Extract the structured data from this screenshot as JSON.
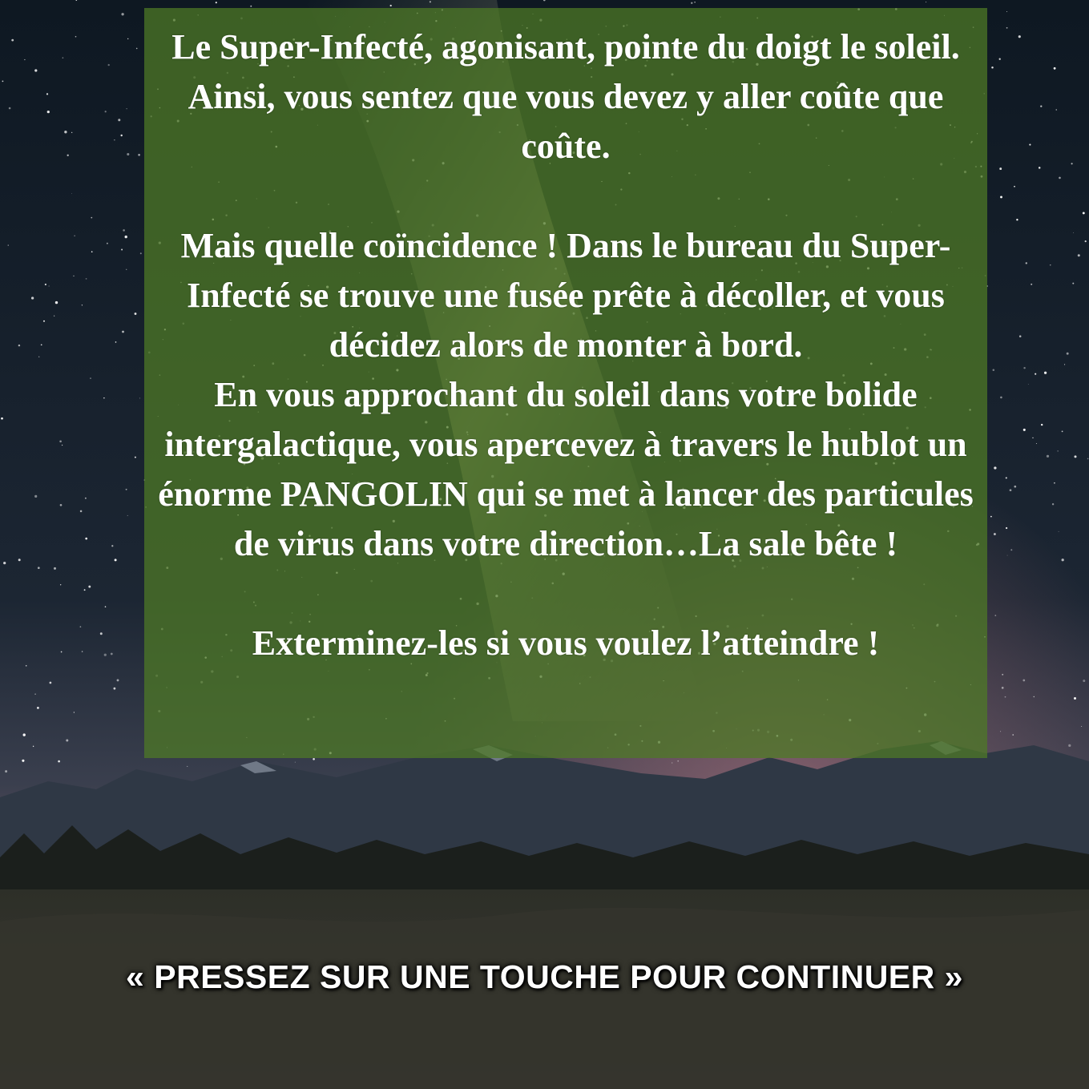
{
  "story": {
    "paragraph_1": "Le Super-Infecté, agonisant, pointe du doigt le soleil. Ainsi, vous sentez que vous devez y aller coûte que coûte.",
    "paragraph_2": "Mais quelle coïncidence ! Dans le bureau du Super-Infecté se trouve une fusée prête à décoller, et vous décidez alors de monter à bord.",
    "paragraph_3": "En vous approchant du soleil dans votre bolide intergalactique, vous apercevez à travers le hublot un énorme PANGOLIN qui se met à lancer des particules de virus dans votre direction…La sale bête !",
    "paragraph_4": "Exterminez-les si vous voulez l’atteindre !"
  },
  "prompt": {
    "continue": "« PRESSEZ SUR UNE TOUCHE POUR CONTINUER »"
  },
  "colors": {
    "panel": "#4e7a26",
    "text": "#ffffff",
    "sky_top": "#0f1a24",
    "sky_bottom": "#2a3340"
  }
}
